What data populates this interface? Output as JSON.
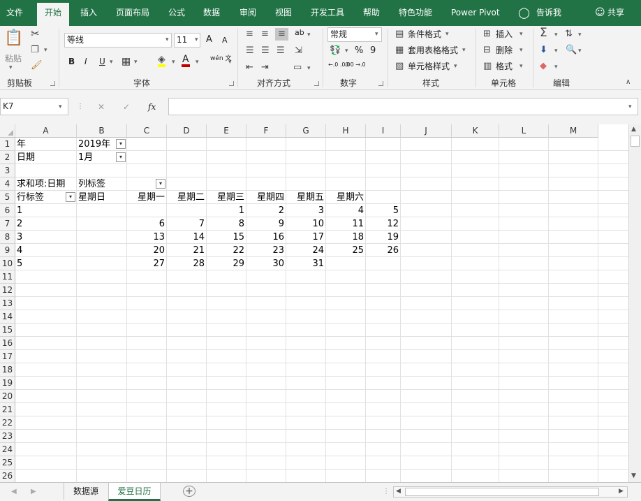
{
  "tabs": {
    "file": "文件",
    "home": "开始",
    "insert": "插入",
    "layout": "页面布局",
    "formulas": "公式",
    "data": "数据",
    "review": "审阅",
    "view": "视图",
    "developer": "开发工具",
    "help": "帮助",
    "special": "特色功能",
    "powerpivot": "Power Pivot",
    "tellme": "告诉我",
    "share": "共享"
  },
  "ribbon": {
    "clipboard": {
      "paste": "粘贴",
      "label": "剪贴板"
    },
    "font": {
      "name": "等线",
      "size": "11",
      "label": "字体",
      "bold": "B",
      "italic": "I",
      "underline": "U",
      "grow": "A",
      "shrink": "A",
      "color_a": "A",
      "phonetic": "wén 文"
    },
    "alignment": {
      "label": "对齐方式",
      "orientation": "ab"
    },
    "number": {
      "format": "常规",
      "label": "数字",
      "percent": "%",
      "comma": "9",
      "inc_decimal": "←.0 .00",
      "dec_decimal": ".00 →.0"
    },
    "styles": {
      "conditional": "条件格式",
      "table": "套用表格格式",
      "cell": "单元格样式",
      "label": "样式"
    },
    "cells": {
      "insert": "插入",
      "delete": "删除",
      "format": "格式",
      "label": "单元格"
    },
    "editing": {
      "label": "编辑"
    }
  },
  "formula_bar": {
    "name_box": "K7",
    "fx": "fx",
    "cancel": "✕",
    "enter": "✓",
    "formula": ""
  },
  "columns": [
    "A",
    "B",
    "C",
    "D",
    "E",
    "F",
    "G",
    "H",
    "I",
    "J",
    "K",
    "L",
    "M"
  ],
  "rows": [
    "1",
    "2",
    "3",
    "4",
    "5",
    "6",
    "7",
    "8",
    "9",
    "10",
    "11",
    "12",
    "13",
    "14",
    "15",
    "16",
    "17",
    "18",
    "19",
    "20",
    "21",
    "22",
    "23",
    "24",
    "25",
    "26"
  ],
  "cells": {
    "a1": "年",
    "b1": "2019年",
    "a2": "日期",
    "b2": "1月",
    "a4": "求和项:日期",
    "b4": "列标签",
    "a5": "行标签",
    "headers": [
      "星期日",
      "星期一",
      "星期二",
      "星期三",
      "星期四",
      "星期五",
      "星期六"
    ],
    "data": [
      [
        "1",
        "",
        "",
        "",
        "1",
        "2",
        "3",
        "4",
        "5"
      ],
      [
        "2",
        "",
        "6",
        "7",
        "8",
        "9",
        "10",
        "11",
        "12"
      ],
      [
        "3",
        "",
        "13",
        "14",
        "15",
        "16",
        "17",
        "18",
        "19"
      ],
      [
        "4",
        "",
        "20",
        "21",
        "22",
        "23",
        "24",
        "25",
        "26"
      ],
      [
        "5",
        "",
        "27",
        "28",
        "29",
        "30",
        "31",
        "",
        ""
      ]
    ]
  },
  "sheets": {
    "sheet1": "数据源",
    "sheet2": "爱豆日历",
    "add": "+"
  },
  "colors": {
    "excel_green": "#217346",
    "ribbon_bg": "#f3f3f3",
    "grid_line": "#e1e1e1"
  }
}
